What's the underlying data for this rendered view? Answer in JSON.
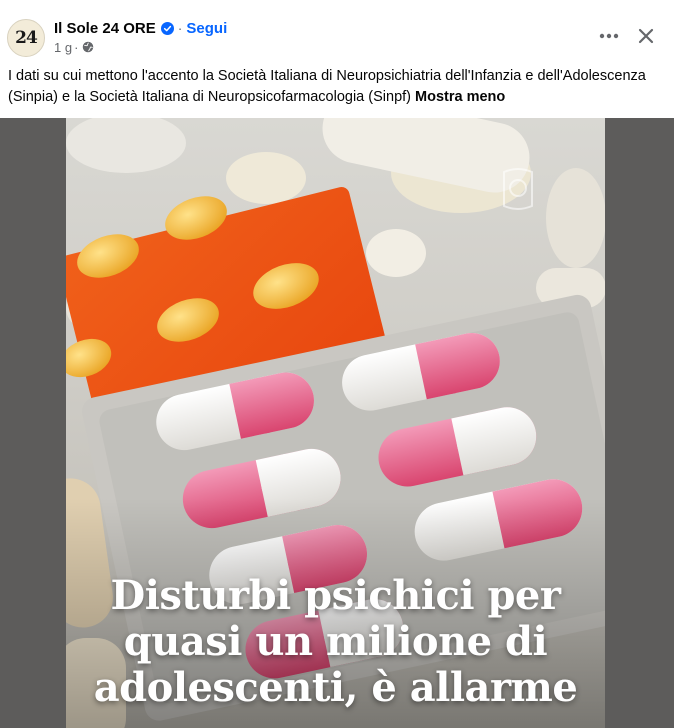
{
  "post": {
    "page_name": "Il Sole 24 ORE",
    "avatar_text": "24",
    "separator": "·",
    "follow_label": "Segui",
    "time": "1 g",
    "time_sep": "·",
    "caption": "I dati su cui mettono l'accento la Società Italiana di Neuropsichiatria dell'Infanzia e dell'Adolescenza (Sinpia) e la Società Italiana di Neuropsicofarmacologia (Sinpf)",
    "see_less_label": "Mostra meno"
  },
  "image": {
    "headline_line1": "Disturbi psichici per",
    "headline_line2": "quasi un milione di",
    "headline_line3": "adolescenti, è allarme"
  },
  "icons": {
    "verified": "verified-badge-icon",
    "privacy": "globe-icon",
    "more": "more-options-icon",
    "close": "close-icon"
  },
  "colors": {
    "link": "#0866ff",
    "meta_text": "#65676b",
    "media_backdrop": "#5d5c5b",
    "verified": "#0866ff"
  }
}
